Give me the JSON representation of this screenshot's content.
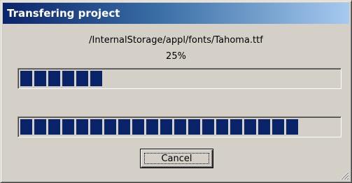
{
  "dialog": {
    "title": "Transfering project",
    "file_path": "/InternalStorage/appl/fonts/Tahoma.ttf",
    "percent_text": "25%"
  },
  "progress_file": {
    "value_fraction": 0.28,
    "color": "#0a246a"
  },
  "progress_total": {
    "value_fraction": 0.86,
    "color": "#0a246a"
  },
  "buttons": {
    "cancel_label": "Cancel"
  },
  "icons": {
    "resize_grip": "resize-grip-icon"
  }
}
